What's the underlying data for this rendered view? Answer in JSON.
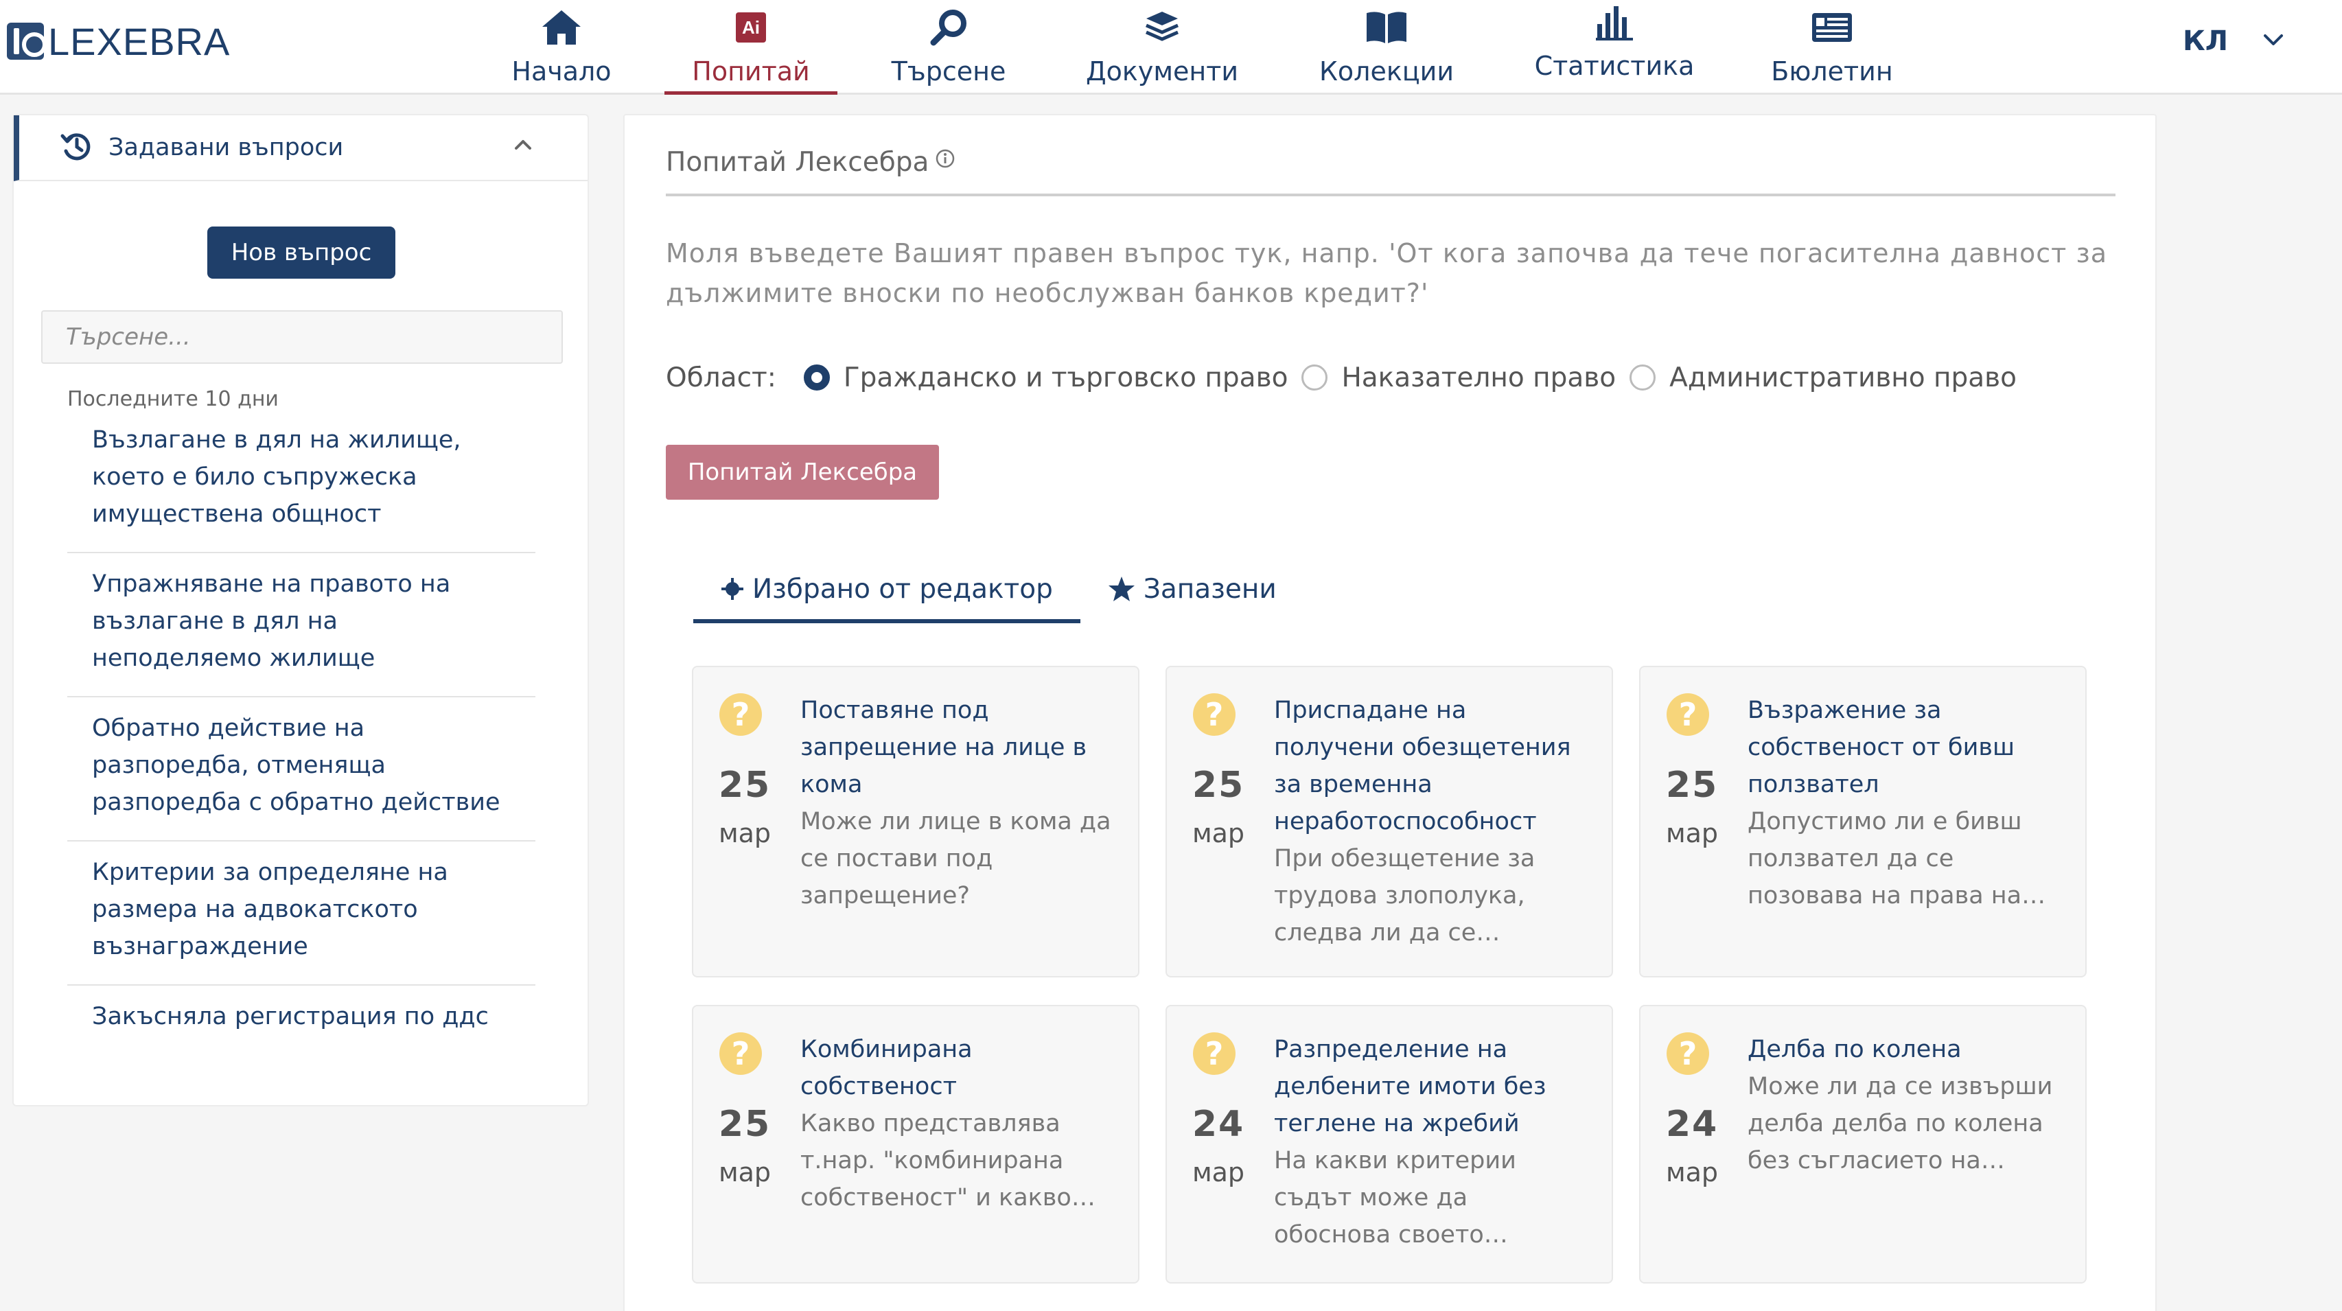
{
  "brand": {
    "logo_text": "LEXEBRA"
  },
  "nav": {
    "items": [
      {
        "label": "Начало",
        "icon": "home-icon"
      },
      {
        "label": "Попитай",
        "icon": "ai-icon",
        "badge": "Ai",
        "active": true
      },
      {
        "label": "Търсене",
        "icon": "search-icon"
      },
      {
        "label": "Документи",
        "icon": "layers-icon"
      },
      {
        "label": "Колекции",
        "icon": "book-icon"
      },
      {
        "label": "Статистика",
        "icon": "bar-chart-icon"
      },
      {
        "label": "Бюлетин",
        "icon": "newspaper-icon"
      }
    ],
    "user_initials": "КЛ"
  },
  "sidebar": {
    "header": "Задавани въпроси",
    "new_question_label": "Нов въпрос",
    "search_placeholder": "Търсене...",
    "section_label": "Последните 10 дни",
    "items": [
      {
        "label": "Възлагане в дял на жилище, което е било съпружеска имуществена общност"
      },
      {
        "label": "Упражняване на правото на възлагане в дял на неподеляемо жилище"
      },
      {
        "label": "Обратно действие на разпоредба, отменяща разпоредба с обратно действие"
      },
      {
        "label": "Критерии за определяне на размера на адвокатското възнаграждение"
      },
      {
        "label": "Закъсняла регистрация по ддс"
      }
    ]
  },
  "main": {
    "title": "Попитай Лексебра",
    "question_placeholder": "Моля въведете Вашият правен въпрос тук, напр. 'От кога започва да тече погасителна давност за дължимите вноски по необслужван банков кредит?'",
    "area_label": "Област:",
    "areas": [
      {
        "label": "Гражданско и търговско право",
        "checked": true
      },
      {
        "label": "Наказателно право",
        "checked": false
      },
      {
        "label": "Административно право",
        "checked": false
      }
    ],
    "ask_button": "Попитай Лексебра",
    "tabs": [
      {
        "label": "Избрано от редактор",
        "icon": "crosshair-icon",
        "active": true
      },
      {
        "label": "Запазени",
        "icon": "star-icon",
        "active": false
      }
    ],
    "cards": [
      {
        "day": "25",
        "month": "мар",
        "title": "Поставяне под запрещение на лице в кома",
        "desc": "Може ли лице в кома да се постави под запрещение?"
      },
      {
        "day": "25",
        "month": "мар",
        "title": "Приспадане на получени обезщетения за временна неработоспособност",
        "desc": "При обезщетение за трудова злополука, следва ли да се…"
      },
      {
        "day": "25",
        "month": "мар",
        "title": "Възражение за собственост от бивш ползвател",
        "desc": "Допустимо ли е бивш ползвател да се позовава на права на…"
      },
      {
        "day": "25",
        "month": "мар",
        "title": "Комбинирана собственост",
        "desc": "Какво представлява т.нар. \"комбинирана собственост\" и какво е…"
      },
      {
        "day": "24",
        "month": "мар",
        "title": "Разпределение на делбените имоти без теглене на жребий",
        "desc": "На какви критерии съдът може да обоснова своето решение за…"
      },
      {
        "day": "24",
        "month": "мар",
        "title": "Делба по колена",
        "desc": "Може ли да се извърши делба делба по колена без съгласието на всич…"
      }
    ]
  },
  "colors": {
    "brand": "#1f3f6a",
    "accent": "#9b2d3c",
    "ask_button": "#c27785",
    "question_icon": "#f7d57a"
  }
}
